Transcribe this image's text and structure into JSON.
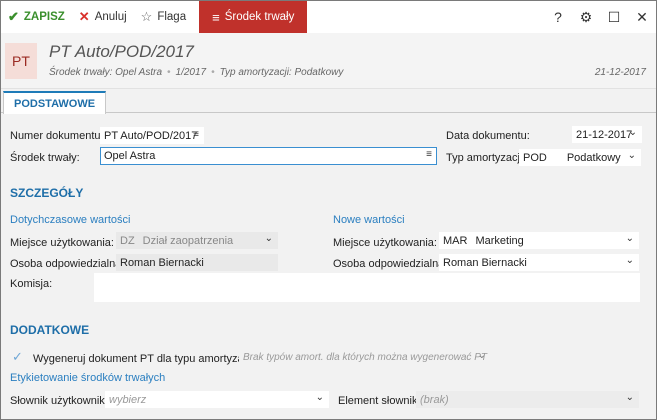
{
  "toolbar": {
    "save_label": "ZAPISZ",
    "cancel_label": "Anuluj",
    "flag_label": "Flaga",
    "tab_label": "Środek trwały"
  },
  "header": {
    "badge": "PT",
    "title": "PT Auto/POD/2017",
    "sub_asset": "Środek trwały: Opel Astra",
    "sub_period": "1/2017",
    "sub_amort": "Typ amortyzacji: Podatkowy",
    "date": "21-12-2017"
  },
  "tabs": [
    {
      "label": "PODSTAWOWE"
    }
  ],
  "basic": {
    "doc_number_label": "Numer dokumentu:",
    "doc_number_value": "PT Auto/POD/2017",
    "asset_label": "Środek trwały:",
    "asset_value": "Opel Astra",
    "doc_date_label": "Data dokumentu:",
    "doc_date_value": "21-12-2017",
    "amort_label": "Typ amortyzacji:",
    "amort_code": "POD",
    "amort_value": "Podatkowy"
  },
  "details": {
    "title": "SZCZEGÓŁY",
    "old_title": "Dotychczasowe wartości",
    "new_title": "Nowe wartości",
    "place_label": "Miejsce użytkowania:",
    "old_place_code": "DZ",
    "old_place_value": "Dział zaopatrzenia",
    "person_label": "Osoba odpowiedzialna:",
    "old_person_value": "Roman Biernacki",
    "new_place_code": "MAR",
    "new_place_value": "Marketing",
    "new_person_value": "Roman Biernacki",
    "commission_label": "Komisja:",
    "commission_value": ""
  },
  "additional": {
    "title": "DODATKOWE",
    "regen_label": "Wygeneruj dokument PT dla typu amortyzacji:",
    "regen_placeholder": "Brak typów amort. dla których można wygenerować PT",
    "labeling_title": "Etykietowanie środków trwałych",
    "dict_label": "Słownik użytkownika:",
    "dict_placeholder": "wybierz",
    "element_label": "Element słownika:",
    "element_placeholder": "(brak)"
  },
  "icons": {
    "save": "check-icon",
    "cancel": "x-icon",
    "flag": "star-icon",
    "tab": "menu-icon",
    "help": "question-icon",
    "settings": "gear-icon",
    "maximize": "maximize-icon",
    "close": "close-icon"
  },
  "colors": {
    "accent": "#1e6ea8",
    "tab_red": "#c0312b",
    "save_green": "#3a8f2c",
    "badge_bg": "#f5ddd8"
  }
}
